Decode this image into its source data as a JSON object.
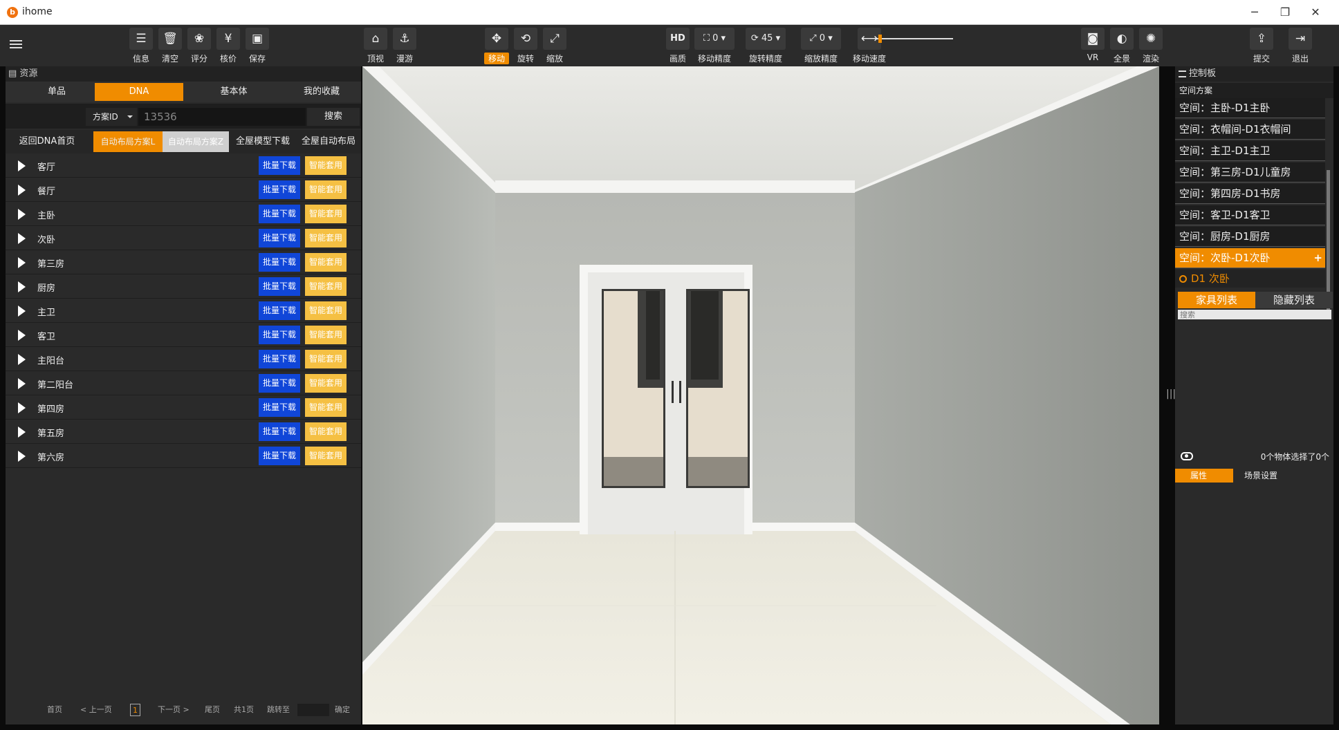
{
  "window": {
    "title": "ihome",
    "icon_letter": "b",
    "controls": [
      "minimize-icon",
      "restore-icon",
      "close-icon"
    ],
    "control_glyphs": [
      "─",
      "❐",
      "✕"
    ]
  },
  "toolbar": {
    "groups": [
      {
        "items": [
          {
            "label": "信息",
            "icon": "doc-icon",
            "glyph": "☰"
          },
          {
            "label": "清空",
            "icon": "trash-icon",
            "glyph": "🗑"
          },
          {
            "label": "评分",
            "icon": "paw-icon",
            "glyph": "❀"
          },
          {
            "label": "核价",
            "icon": "yen-icon",
            "glyph": "¥"
          },
          {
            "label": "保存",
            "icon": "save-icon",
            "glyph": "▣"
          }
        ]
      },
      {
        "items": [
          {
            "label": "顶视",
            "icon": "top-view-icon",
            "glyph": "⌂"
          },
          {
            "label": "漫游",
            "icon": "walk-icon",
            "glyph": "⚓"
          }
        ]
      },
      {
        "items": [
          {
            "label": "移动",
            "icon": "move-icon",
            "glyph": "✥",
            "active": true
          },
          {
            "label": "旋转",
            "icon": "rotate-icon",
            "glyph": "⟲"
          },
          {
            "label": "缩放",
            "icon": "scale-icon",
            "glyph": "⤢"
          }
        ]
      }
    ],
    "quality": {
      "label": "画质",
      "value": "HD"
    },
    "move_precision": {
      "label": "移动精度",
      "value": "0"
    },
    "rotate_precision": {
      "label": "旋转精度",
      "value": "45"
    },
    "scale_precision": {
      "label": "缩放精度",
      "value": "0"
    },
    "move_speed": {
      "label": "移动速度",
      "value": 0.02
    },
    "right": [
      {
        "label": "VR",
        "icon": "vr-icon",
        "glyph": "◙"
      },
      {
        "label": "全景",
        "icon": "panorama-icon",
        "glyph": "◐"
      },
      {
        "label": "渲染",
        "icon": "render-icon",
        "glyph": "✺"
      }
    ],
    "far_right": [
      {
        "label": "提交",
        "icon": "submit-icon",
        "glyph": "⇪"
      },
      {
        "label": "退出",
        "icon": "exit-icon",
        "glyph": "⇥"
      }
    ]
  },
  "left": {
    "header": "资源",
    "tabs": [
      "单品",
      "DNA",
      "基本体",
      "我的收藏"
    ],
    "active_tab": "DNA",
    "search": {
      "select_label": "方案ID",
      "value": "13536",
      "button": "搜索"
    },
    "subbuttons": [
      "返回DNA首页",
      "自动布局方案L",
      "自动布局方案Z",
      "全屋模型下载",
      "全屋自动布局"
    ],
    "rooms": [
      "客厅",
      "餐厅",
      "主卧",
      "次卧",
      "第三房",
      "厨房",
      "主卫",
      "客卫",
      "主阳台",
      "第二阳台",
      "第四房",
      "第五房",
      "第六房"
    ],
    "batch_label": "批量下载",
    "smart_label": "智能套用",
    "pager": {
      "first": "首页",
      "prev": "< 上一页",
      "page": "1",
      "next": "下一页 >",
      "last": "尾页",
      "total": "共1页",
      "jump": "跳转至",
      "confirm": "确定"
    }
  },
  "right": {
    "header": "控制板",
    "subheader": "空间方案",
    "spaces": [
      "空间：主卧-D1主卧",
      "空间：衣帽间-D1衣帽间",
      "空间：主卫-D1主卫",
      "空间：第三房-D1儿童房",
      "空间：第四房-D1书房",
      "空间：客卫-D1客卫",
      "空间：厨房-D1厨房",
      "空间：次卧-D1次卧"
    ],
    "active_space": "空间：次卧-D1次卧",
    "plus": "+",
    "selected_scheme": "D1 次卧",
    "furniture_tabs": [
      "家具列表",
      "隐藏列表"
    ],
    "search_placeholder": "搜索",
    "selection_count": "0个物体选择了0个",
    "prop_tabs": [
      "属性",
      "场景设置"
    ]
  },
  "colors": {
    "accent": "#f08c00",
    "blue_button": "#1046d8",
    "yellow_button": "#f5c043"
  }
}
